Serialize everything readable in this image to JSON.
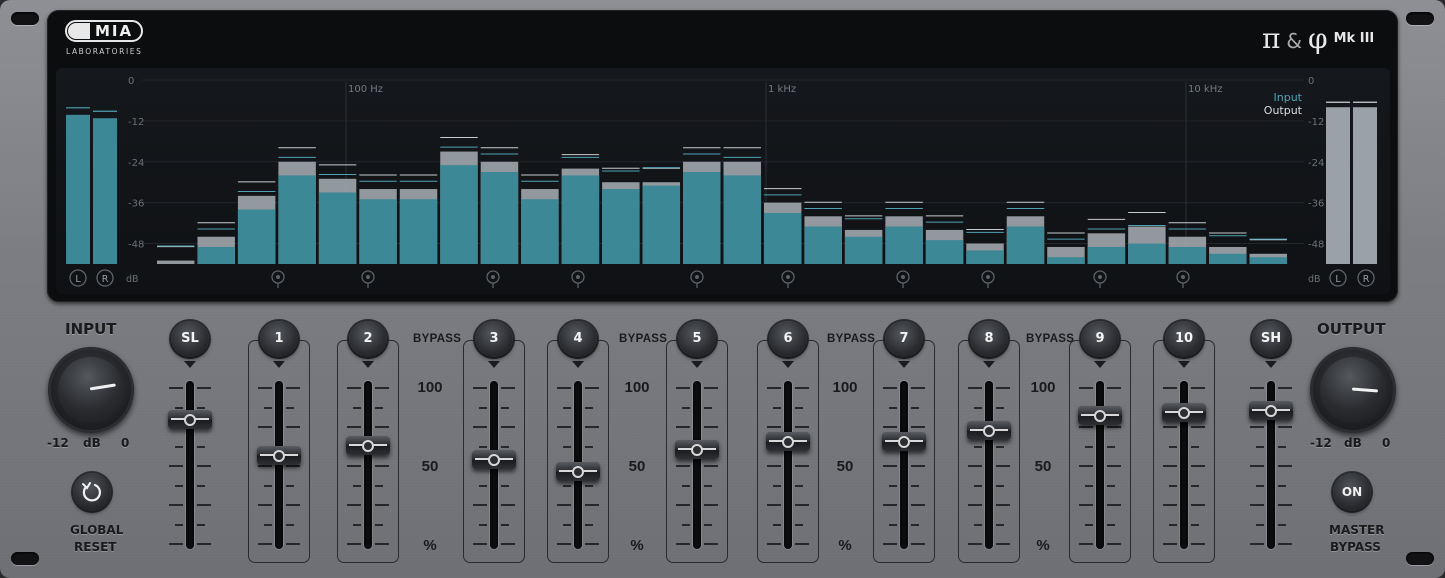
{
  "brand": {
    "logo_text": "MIA",
    "logo_subtitle": "LABORATORIES",
    "pi": "π",
    "amp": "&",
    "phi": "φ",
    "model": "Mk III"
  },
  "display": {
    "db_ticks": [
      "0",
      "-12",
      "-24",
      "-36",
      "-48"
    ],
    "freq_labels": [
      "100 Hz",
      "1 kHz",
      "10 kHz"
    ],
    "legend_input": "Input",
    "legend_output": "Output",
    "db_unit": "dB",
    "left_channel": "L",
    "right_channel": "R"
  },
  "colors": {
    "input_bar": "#3d8897",
    "output_bar": "#a9b0b6",
    "accent": "#4fa3b5"
  },
  "meters": {
    "left_input_db": [
      -2,
      -3
    ],
    "right_output_db": [
      -3,
      -3
    ]
  },
  "chart_data": {
    "type": "bar",
    "ylim": [
      -54,
      0
    ],
    "ylabel": "dB",
    "series": [
      {
        "name": "Input",
        "values": [
          -54,
          -49,
          -38,
          -28,
          -33,
          -35,
          -35,
          -25,
          -27,
          -35,
          -28,
          -32,
          -31,
          -27,
          -28,
          -39,
          -43,
          -46,
          -43,
          -47,
          -50,
          -43,
          -52,
          -49,
          -48,
          -49,
          -51,
          -52
        ]
      },
      {
        "name": "Output",
        "values": [
          -53,
          -46,
          -34,
          -24,
          -29,
          -32,
          -32,
          -21,
          -24,
          -32,
          -26,
          -30,
          -30,
          -24,
          -24,
          -36,
          -40,
          -44,
          -40,
          -44,
          -48,
          -40,
          -49,
          -45,
          -43,
          -46,
          -49,
          -51
        ]
      }
    ]
  },
  "input": {
    "title": "INPUT",
    "min": "-12",
    "unit": "dB",
    "max": "0",
    "value_fraction": 0.8
  },
  "output": {
    "title": "OUTPUT",
    "min": "-12",
    "unit": "dB",
    "max": "0",
    "value_fraction": 0.85
  },
  "global_reset": {
    "line1": "GLOBAL",
    "line2": "RESET"
  },
  "master_bypass": {
    "button": "ON",
    "line1": "MASTER",
    "line2": "BYPASS"
  },
  "scale": {
    "bypass": "BYPASS",
    "top": "100",
    "mid": "50",
    "unit": "%"
  },
  "bands": [
    {
      "label": "SL",
      "value": 82
    },
    {
      "label": "1",
      "value": 57
    },
    {
      "label": "2",
      "value": 64
    },
    {
      "label": "3",
      "value": 54
    },
    {
      "label": "4",
      "value": 46
    },
    {
      "label": "5",
      "value": 61
    },
    {
      "label": "6",
      "value": 67
    },
    {
      "label": "7",
      "value": 67
    },
    {
      "label": "8",
      "value": 74
    },
    {
      "label": "9",
      "value": 85
    },
    {
      "label": "10",
      "value": 87
    },
    {
      "label": "SH",
      "value": 88
    }
  ]
}
